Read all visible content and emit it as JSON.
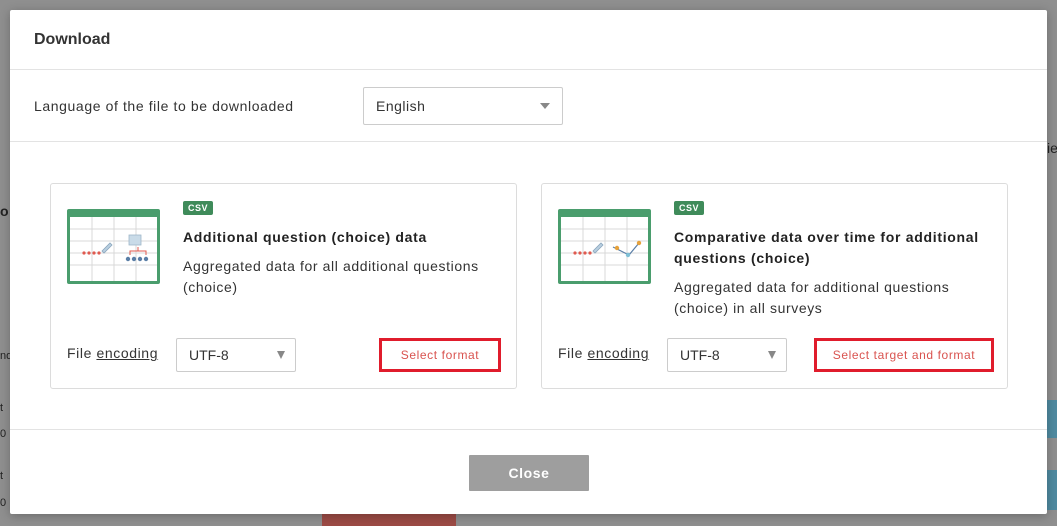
{
  "background": {
    "fragments": [
      "o",
      "ie",
      "nd",
      "t",
      "0",
      "t",
      "0"
    ]
  },
  "modal": {
    "title": "Download",
    "language_label": "Language of the file to be downloaded",
    "language_select": {
      "value": "English"
    }
  },
  "cards": [
    {
      "badge": "CSV",
      "title": "Additional question (choice) data",
      "description": "Aggregated data for all additional questions (choice)",
      "encoding_label_prefix": "File ",
      "encoding_label_link": "encoding",
      "encoding_value": "UTF-8",
      "action_label": "Select format"
    },
    {
      "badge": "CSV",
      "title": "Comparative data over time for additional questions (choice)",
      "description": "Aggregated data for additional questions (choice) in all surveys",
      "encoding_label_prefix": "File ",
      "encoding_label_link": "encoding",
      "encoding_value": "UTF-8",
      "action_label": "Select target and format"
    }
  ],
  "footer": {
    "close_label": "Close"
  },
  "colors": {
    "accent_green": "#4a9d6d",
    "badge_green": "#3f8b5a",
    "highlight_red": "#e01c2c",
    "button_gray": "#9e9e9e"
  }
}
